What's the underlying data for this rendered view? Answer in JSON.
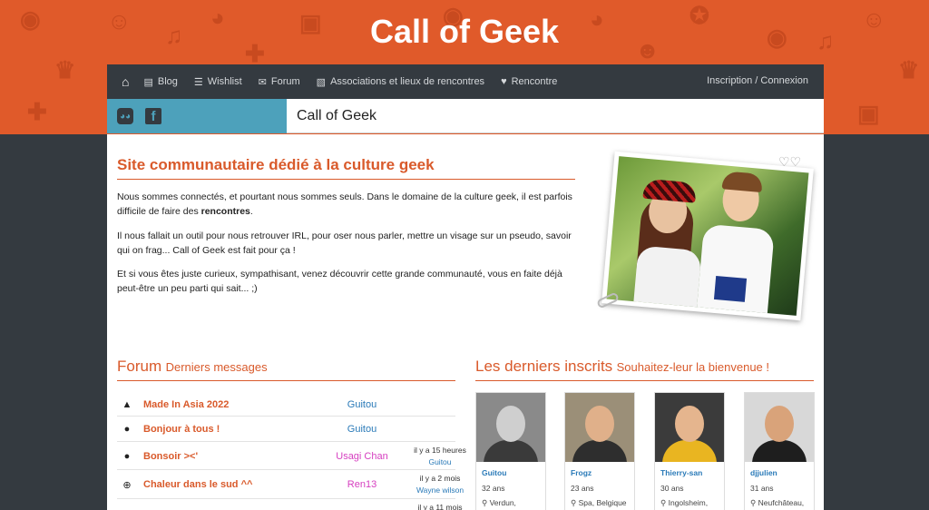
{
  "site": {
    "title": "Call of Geek",
    "page_title": "Call of Geek"
  },
  "nav": {
    "home_icon": "home-icon",
    "items": [
      {
        "label": "Blog",
        "icon": "newspaper-icon"
      },
      {
        "label": "Wishlist",
        "icon": "list-icon"
      },
      {
        "label": "Forum",
        "icon": "comments-icon"
      },
      {
        "label": "Associations et lieux de rencontres",
        "icon": "map-icon"
      },
      {
        "label": "Rencontre",
        "icon": "heart-icon"
      }
    ],
    "auth": "Inscription / Connexion"
  },
  "social": {
    "icons": [
      "discord-icon",
      "facebook-icon"
    ]
  },
  "intro": {
    "title": "Site communautaire dédié à la culture geek",
    "p1_start": "Nous sommes connectés, et pourtant nous sommes seuls. Dans le domaine de la culture geek, il est parfois difficile de faire des ",
    "p1_bold": "rencontres",
    "p1_end": ".",
    "p2": "Il nous fallait un outil pour nous retrouver IRL, pour oser nous parler, mettre un visage sur un pseudo, savoir qui on frag... Call of Geek est fait pour ça !",
    "p3": "Et si vous êtes juste curieux, sympathisant, venez découvrir cette grande communauté, vous en faite déjà peut-être un peu parti qui sait... ;)"
  },
  "forum": {
    "title": "Forum",
    "subtitle": "Derniers messages",
    "rows": [
      {
        "icon": "road-icon",
        "subject": "Made In Asia 2022",
        "user": "Guitou",
        "user_color": "#2a7ab8",
        "time": "",
        "last_user": ""
      },
      {
        "icon": "user-icon",
        "subject": "Bonjour à tous !",
        "user": "Guitou",
        "user_color": "#2a7ab8",
        "time": "",
        "last_user": ""
      },
      {
        "icon": "user-icon",
        "subject": "Bonsoir ><'",
        "user": "Usagi Chan",
        "user_color": "#d63fc0",
        "time": "il y a 15 heures",
        "last_user": "Guitou"
      },
      {
        "icon": "globe-icon",
        "subject": "Chaleur dans le sud ^^",
        "user": "Ren13",
        "user_color": "#d63fc0",
        "time": "il y a 2 mois",
        "last_user": "Wayne wilson"
      },
      {
        "icon": "user-icon",
        "subject": "",
        "user": "",
        "user_color": "#2a7ab8",
        "time": "il y a 11 mois",
        "last_user": ""
      }
    ]
  },
  "members": {
    "title": "Les derniers inscrits",
    "subtitle": "Souhaitez-leur la bienvenue !",
    "list": [
      {
        "name": "Guitou",
        "age": "32 ans",
        "location": "Verdun,",
        "bg": "#8a8a8a",
        "face": "#cfcfcf",
        "cloth": "#3a3a3a"
      },
      {
        "name": "Frogz",
        "age": "23 ans",
        "location": "Spa, Belgique",
        "bg": "#9b8f78",
        "face": "#e0b08a",
        "cloth": "#2e2e2e"
      },
      {
        "name": "Thierry-san",
        "age": "30 ans",
        "location": "Ingolsheim,",
        "bg": "#3b3b3b",
        "face": "#e5b58e",
        "cloth": "#e9b521"
      },
      {
        "name": "djjulien",
        "age": "31 ans",
        "location": "Neufchâteau,",
        "bg": "#d8d8d8",
        "face": "#d9a37a",
        "cloth": "#1e1e1e"
      }
    ],
    "location_icon": "map-marker-icon"
  },
  "colors": {
    "accent": "#d95a2b",
    "nav_bg": "#343a40",
    "social_bg": "#4da1bb",
    "link": "#2a7ab8"
  }
}
